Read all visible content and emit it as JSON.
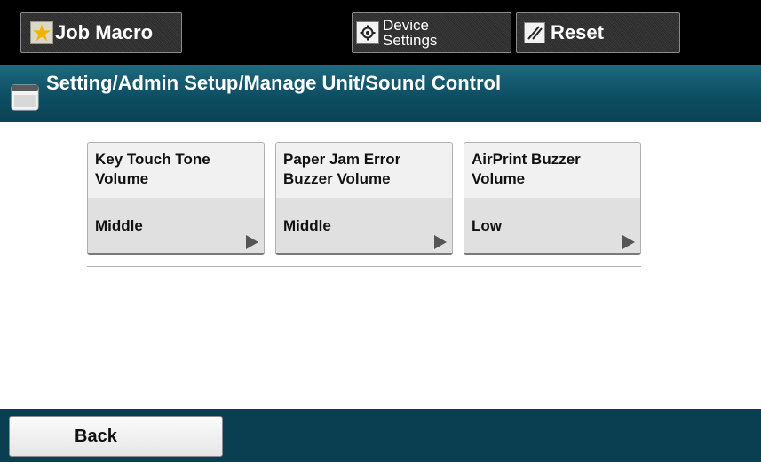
{
  "toolbar": {
    "job_macro_label": "Job Macro",
    "device_settings_label_line1": "Device",
    "device_settings_label_line2": "Settings",
    "reset_label": "Reset"
  },
  "breadcrumb": {
    "title": "Setting/Admin Setup/Manage Unit/Sound Control"
  },
  "settings": [
    {
      "name": "Key Touch Tone\nVolume",
      "value": "Middle"
    },
    {
      "name": "Paper Jam Error\nBuzzer Volume",
      "value": "Middle"
    },
    {
      "name": "AirPrint Buzzer\nVolume",
      "value": "Low"
    }
  ],
  "footer": {
    "back_label": "Back"
  },
  "colors": {
    "header_background": "#000000",
    "title_bar": "#0d4e63",
    "footer_bar": "#0a3f51",
    "job_macro_star": "#f0b400"
  },
  "icons": {
    "job_macro": "star-icon",
    "device_settings": "gear-icon",
    "reset": "reset-icon",
    "breadcrumb": "folder-icon",
    "tile_arrow": "arrow-right-icon"
  }
}
